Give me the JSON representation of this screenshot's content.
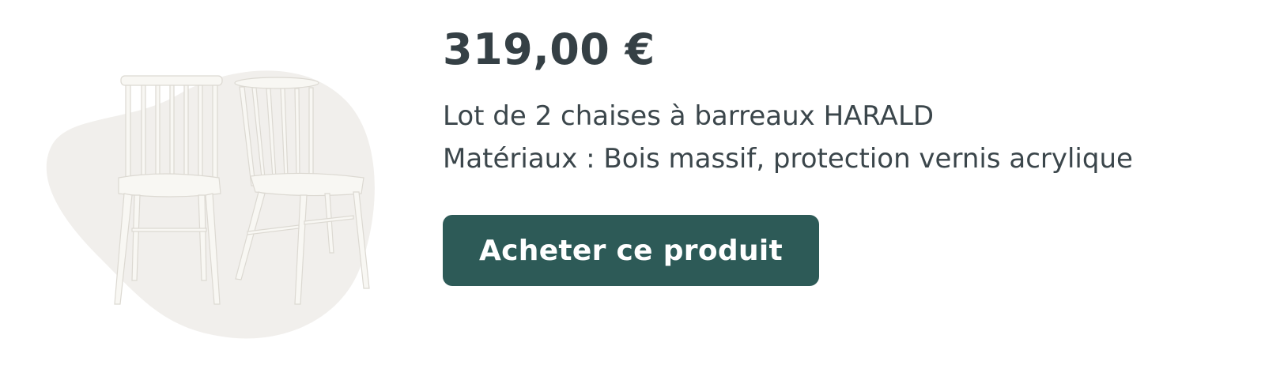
{
  "product": {
    "image_name": "chair-pair-image",
    "price": "319,00 €",
    "title": "Lot de 2 chaises à barreaux HARALD",
    "materials": "Matériaux : Bois massif, protection vernis acrylique",
    "buy_label": "Acheter ce produit"
  },
  "colors": {
    "button_bg": "#2d5a57",
    "text": "#354045",
    "blob": "#f1efec",
    "chair": "#f7f6f2"
  }
}
